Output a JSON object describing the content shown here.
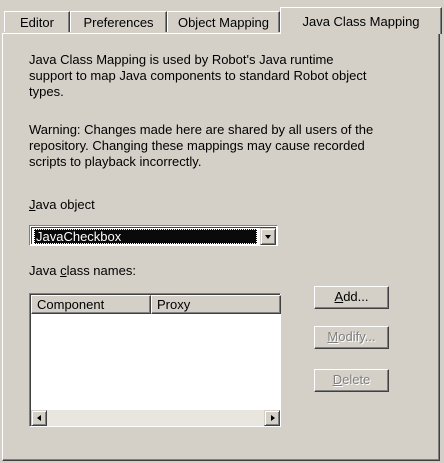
{
  "tabs": [
    {
      "label": "Editor",
      "active": false
    },
    {
      "label": "Preferences",
      "active": false
    },
    {
      "label": "Object Mapping",
      "active": false
    },
    {
      "label": "Java Class Mapping",
      "active": true
    }
  ],
  "description": {
    "line1": "Java Class Mapping is used by Robot's Java runtime",
    "line2": "support to map Java components to standard Robot object",
    "line3": "types."
  },
  "warning": {
    "line1": "Warning: Changes made here are shared by all users of the",
    "line2": "repository.  Changing these mappings may cause recorded",
    "line3": "scripts to playback incorrectly."
  },
  "java_object": {
    "label_mnemonic": "J",
    "label_rest": "ava object",
    "selected_value": "JavaCheckbox"
  },
  "class_names": {
    "label_pre": "Java ",
    "label_mnemonic": "c",
    "label_rest": "lass names:",
    "columns": [
      "Component",
      "Proxy"
    ],
    "rows": []
  },
  "buttons": {
    "add": {
      "mnemonic": "A",
      "rest": "dd...",
      "enabled": true
    },
    "modify": {
      "mnemonic": "M",
      "rest": "odify...",
      "enabled": false
    },
    "delete": {
      "mnemonic": "D",
      "rest": "elete",
      "enabled": false
    }
  }
}
